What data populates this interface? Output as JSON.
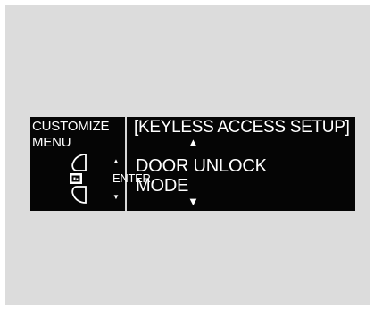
{
  "display": {
    "left_label": "CUSTOMIZE\nMENU",
    "title": "[KEYLESS ACCESS SETUP]",
    "item": "DOOR UNLOCK\nMODE",
    "up_arrow": "▲",
    "down_arrow": "▼",
    "small_up": "▲",
    "small_down": "▼",
    "enter_label": "ENTER"
  },
  "colors": {
    "panel_bg": "#dcdcdc",
    "screen_bg": "#050505",
    "text": "#ffffff"
  },
  "icons": {
    "selector": "selector-knob-icon",
    "enter_button": "enter-button-icon"
  }
}
